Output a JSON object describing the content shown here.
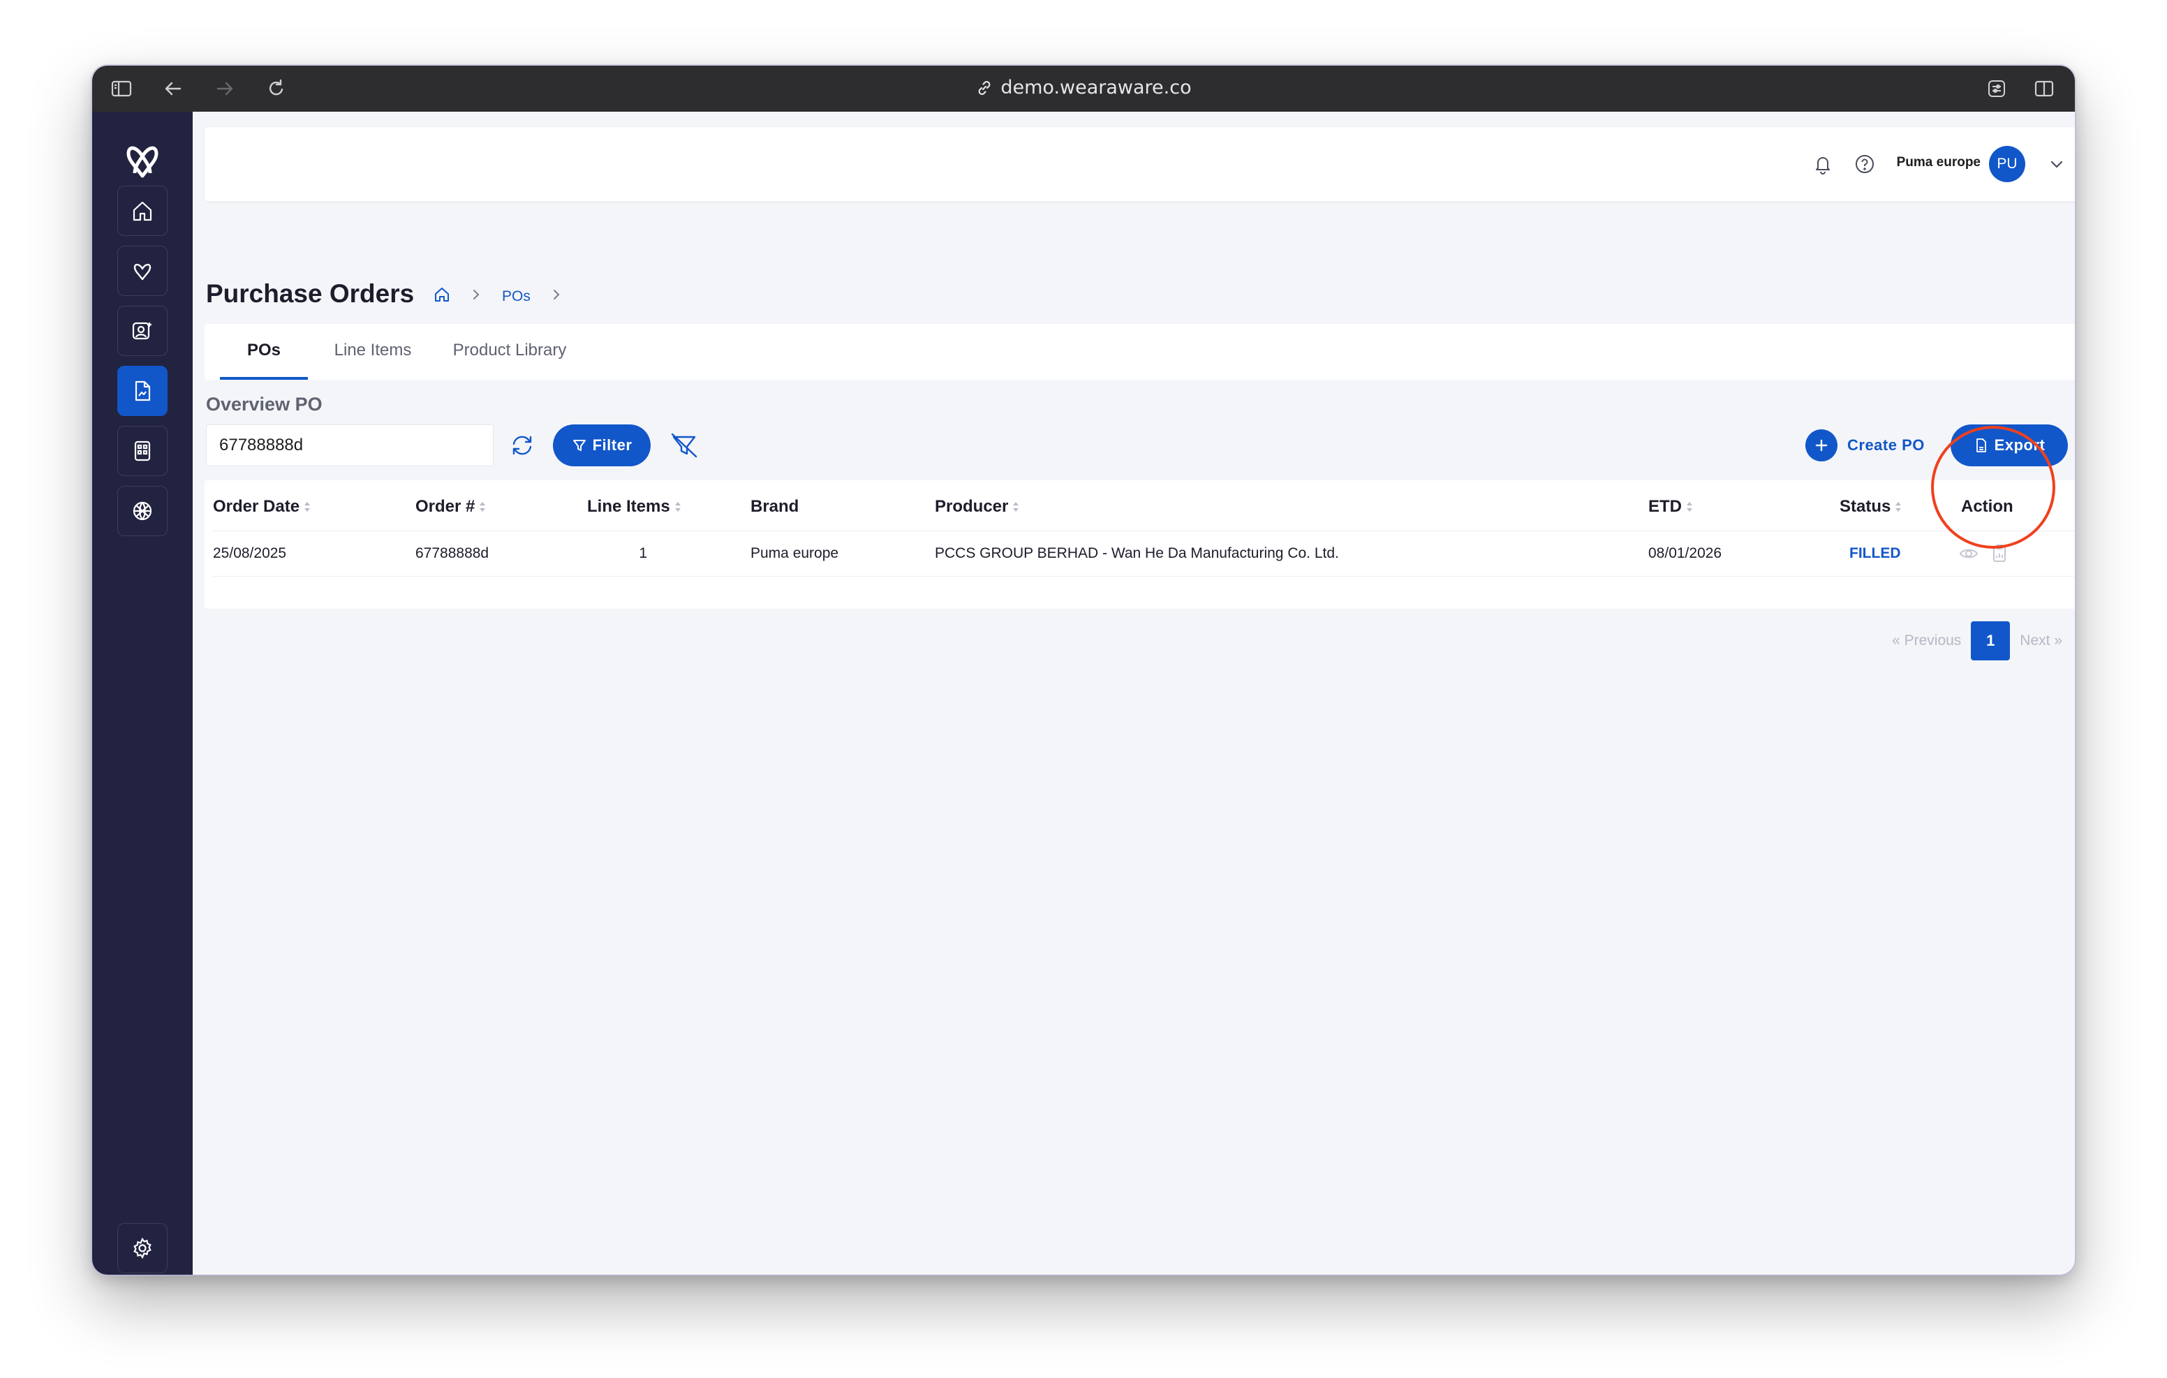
{
  "browser": {
    "url": "demo.wearaware.co"
  },
  "user": {
    "name": "Puma europe",
    "initials": "PU"
  },
  "page": {
    "title": "Purchase Orders",
    "breadcrumb": [
      "POs"
    ]
  },
  "tabs": [
    {
      "label": "POs",
      "active": true
    },
    {
      "label": "Line Items",
      "active": false
    },
    {
      "label": "Product Library",
      "active": false
    }
  ],
  "overview": {
    "label": "Overview PO",
    "search_value": "67788888d",
    "filter_label": "Filter",
    "create_label": "Create PO",
    "export_label": "Export"
  },
  "table": {
    "columns": [
      "Order Date",
      "Order #",
      "Line Items",
      "Brand",
      "Producer",
      "ETD",
      "Status",
      "Action"
    ],
    "rows": [
      {
        "order_date": "25/08/2025",
        "order_no": "67788888d",
        "line_items": "1",
        "brand": "Puma europe",
        "producer": "PCCS GROUP BERHAD - Wan He Da Manufacturing Co. Ltd.",
        "etd": "08/01/2026",
        "status": "FILLED"
      }
    ]
  },
  "pagination": {
    "previous": "Previous",
    "current": "1",
    "next": "Next"
  },
  "colors": {
    "accent": "#1257c9",
    "sidebar": "#222340",
    "annotation": "#f0401e"
  }
}
